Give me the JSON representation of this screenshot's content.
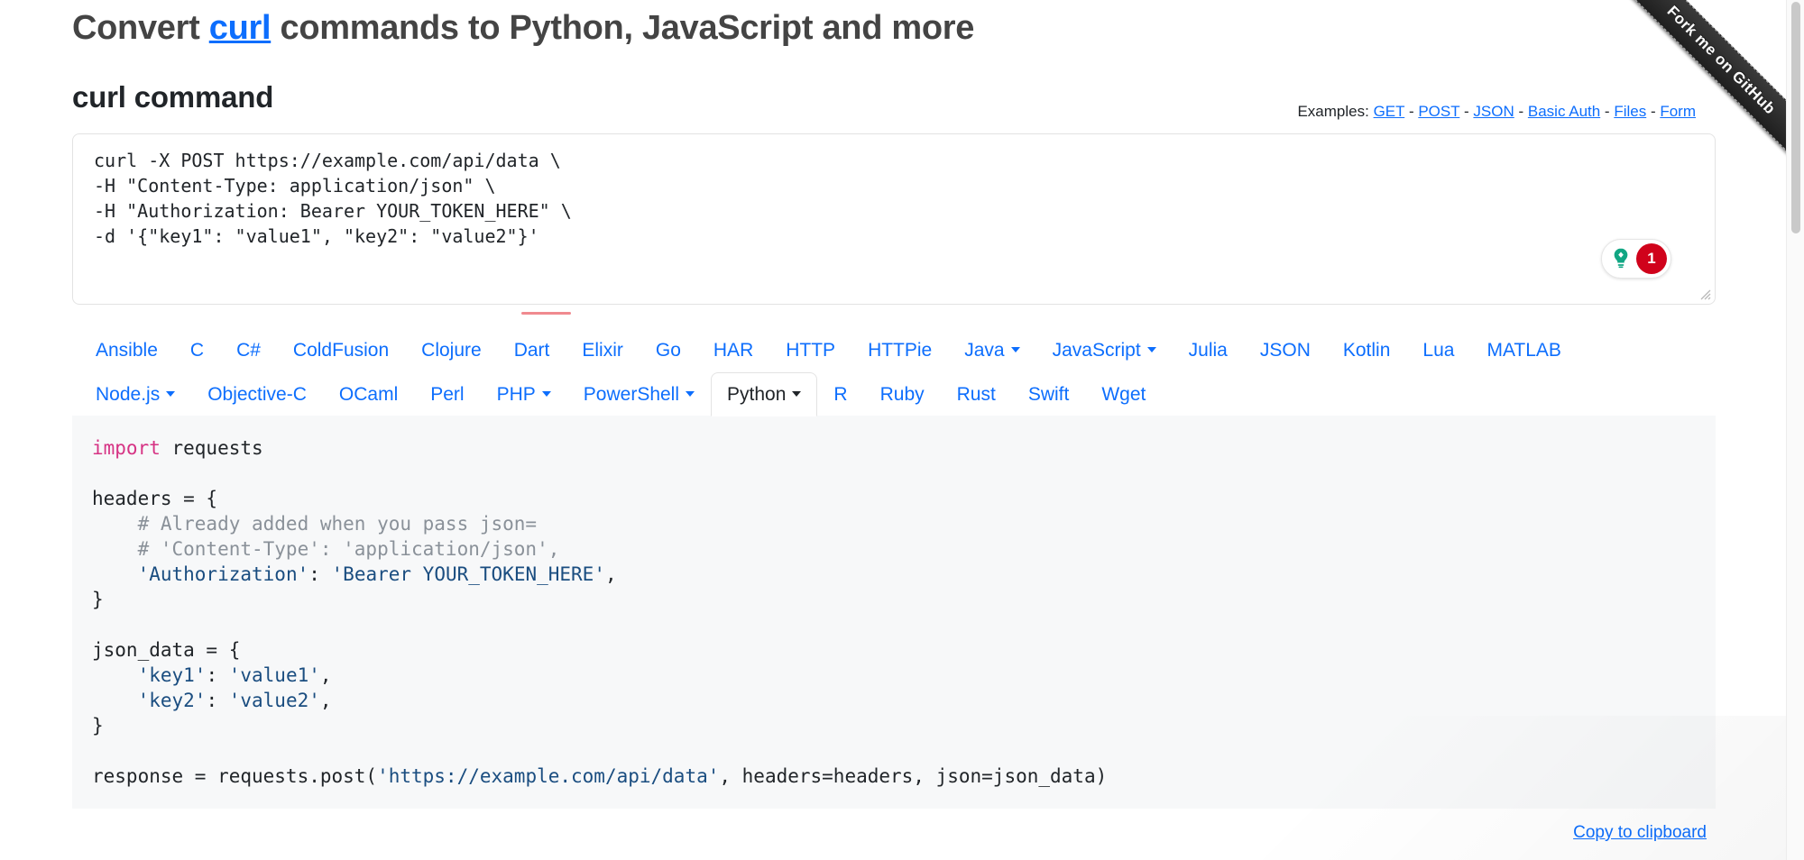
{
  "page": {
    "title_prefix": "Convert ",
    "title_link": "curl",
    "title_suffix": " commands to Python, JavaScript and more",
    "section_title": "curl command"
  },
  "examples": {
    "label": "Examples:",
    "separator": "-",
    "links": [
      "GET",
      "POST",
      "JSON",
      "Basic Auth",
      "Files",
      "Form"
    ]
  },
  "github_ribbon": {
    "label": "Fork me on GitHub"
  },
  "curl_input": {
    "value": "curl -X POST https://example.com/api/data \\\n-H \"Content-Type: application/json\" \\\n-H \"Authorization: Bearer YOUR_TOKEN_HERE\" \\\n-d '{\"key1\": \"value1\", \"key2\": \"value2\"}'",
    "placeholder": "curl command",
    "spellcheck_word": "json"
  },
  "grammarly": {
    "icon": "lightbulb-icon",
    "count": "1",
    "accent_green": "#11a683",
    "accent_red": "#d0021b"
  },
  "tabs": {
    "active": "Python",
    "row1": [
      {
        "label": "Ansible",
        "dropdown": false
      },
      {
        "label": "C",
        "dropdown": false
      },
      {
        "label": "C#",
        "dropdown": false
      },
      {
        "label": "ColdFusion",
        "dropdown": false
      },
      {
        "label": "Clojure",
        "dropdown": false
      },
      {
        "label": "Dart",
        "dropdown": false
      },
      {
        "label": "Elixir",
        "dropdown": false
      },
      {
        "label": "Go",
        "dropdown": false
      },
      {
        "label": "HAR",
        "dropdown": false
      },
      {
        "label": "HTTP",
        "dropdown": false
      },
      {
        "label": "HTTPie",
        "dropdown": false
      },
      {
        "label": "Java",
        "dropdown": true
      },
      {
        "label": "JavaScript",
        "dropdown": true
      },
      {
        "label": "Julia",
        "dropdown": false
      },
      {
        "label": "JSON",
        "dropdown": false
      },
      {
        "label": "Kotlin",
        "dropdown": false
      },
      {
        "label": "Lua",
        "dropdown": false
      },
      {
        "label": "MATLAB",
        "dropdown": false
      }
    ],
    "row2": [
      {
        "label": "Node.js",
        "dropdown": true
      },
      {
        "label": "Objective-C",
        "dropdown": false
      },
      {
        "label": "OCaml",
        "dropdown": false
      },
      {
        "label": "Perl",
        "dropdown": false
      },
      {
        "label": "PHP",
        "dropdown": true
      },
      {
        "label": "PowerShell",
        "dropdown": true
      },
      {
        "label": "Python",
        "dropdown": true
      },
      {
        "label": "R",
        "dropdown": false
      },
      {
        "label": "Ruby",
        "dropdown": false
      },
      {
        "label": "Rust",
        "dropdown": false
      },
      {
        "label": "Swift",
        "dropdown": false
      },
      {
        "label": "Wget",
        "dropdown": false
      }
    ]
  },
  "code_output": {
    "language": "Python",
    "lines": [
      [
        {
          "t": "import",
          "c": "kw"
        },
        {
          "t": " requests",
          "c": "plain"
        }
      ],
      [],
      [
        {
          "t": "headers = {",
          "c": "plain"
        }
      ],
      [
        {
          "t": "    # Already added when you pass json=",
          "c": "comment"
        }
      ],
      [
        {
          "t": "    # 'Content-Type': 'application/json',",
          "c": "comment"
        }
      ],
      [
        {
          "t": "    ",
          "c": "plain"
        },
        {
          "t": "'Authorization'",
          "c": "str"
        },
        {
          "t": ": ",
          "c": "plain"
        },
        {
          "t": "'Bearer YOUR_TOKEN_HERE'",
          "c": "str"
        },
        {
          "t": ",",
          "c": "plain"
        }
      ],
      [
        {
          "t": "}",
          "c": "plain"
        }
      ],
      [],
      [
        {
          "t": "json_data = {",
          "c": "plain"
        }
      ],
      [
        {
          "t": "    ",
          "c": "plain"
        },
        {
          "t": "'key1'",
          "c": "str"
        },
        {
          "t": ": ",
          "c": "plain"
        },
        {
          "t": "'value1'",
          "c": "str"
        },
        {
          "t": ",",
          "c": "plain"
        }
      ],
      [
        {
          "t": "    ",
          "c": "plain"
        },
        {
          "t": "'key2'",
          "c": "str"
        },
        {
          "t": ": ",
          "c": "plain"
        },
        {
          "t": "'value2'",
          "c": "str"
        },
        {
          "t": ",",
          "c": "plain"
        }
      ],
      [
        {
          "t": "}",
          "c": "plain"
        }
      ],
      [],
      [
        {
          "t": "response = requests.post(",
          "c": "plain"
        },
        {
          "t": "'https://example.com/api/data'",
          "c": "str"
        },
        {
          "t": ", headers=headers, json=json_data)",
          "c": "plain"
        }
      ]
    ]
  },
  "copy": {
    "label": "Copy to clipboard"
  },
  "colors": {
    "link": "#0d6efd",
    "text": "#212529",
    "code_bg": "#f7f8f9",
    "border": "#e3e3e3"
  }
}
